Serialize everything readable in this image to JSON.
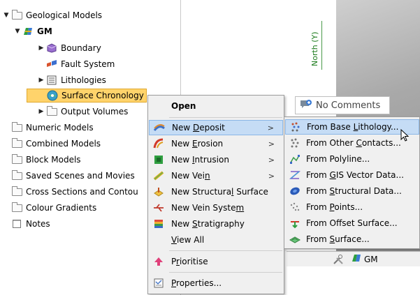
{
  "tree": {
    "items": [
      {
        "label": "Geological Models",
        "arrow": "▼",
        "icon": "folder-icon"
      },
      {
        "label": "GM",
        "arrow": "▼",
        "icon": "geomodel-icon"
      },
      {
        "label": "Boundary",
        "arrow": "▶",
        "icon": "boundary-icon"
      },
      {
        "label": "Fault System",
        "arrow": "",
        "icon": "fault-system-icon"
      },
      {
        "label": "Lithologies",
        "arrow": "▶",
        "icon": "list-icon"
      },
      {
        "label": "Surface Chronology",
        "arrow": "",
        "icon": "surface-chronology-icon"
      },
      {
        "label": "Output Volumes",
        "arrow": "▶",
        "icon": "folder-icon"
      },
      {
        "label": "Numeric Models",
        "arrow": "",
        "icon": "folder-icon"
      },
      {
        "label": "Combined Models",
        "arrow": "",
        "icon": "folder-icon"
      },
      {
        "label": "Block Models",
        "arrow": "",
        "icon": "folder-icon"
      },
      {
        "label": "Saved Scenes and Movies",
        "arrow": "",
        "icon": "folder-icon"
      },
      {
        "label": "Cross Sections and Contou",
        "arrow": "",
        "icon": "folder-icon"
      },
      {
        "label": "Colour Gradients",
        "arrow": "",
        "icon": "folder-icon"
      },
      {
        "label": "Notes",
        "arrow": "",
        "icon": "notes-icon"
      }
    ]
  },
  "viewport": {
    "axis_label": "North (Y)",
    "comment_label": "No Comments",
    "bottom_gm_label": "GM"
  },
  "context_menu": {
    "open": "Open",
    "new_deposit": {
      "pre": "New ",
      "u": "D",
      "post": "eposit"
    },
    "new_erosion": {
      "pre": "New ",
      "u": "E",
      "post": "rosion"
    },
    "new_intrusion": {
      "pre": "New ",
      "u": "I",
      "post": "ntrusion"
    },
    "new_vein": {
      "pre": "New Vei",
      "u": "n",
      "post": ""
    },
    "new_structural_surface": {
      "pre": "New Structura",
      "u": "l",
      "post": " Surface"
    },
    "new_vein_system": {
      "pre": "New Vein Syste",
      "u": "m",
      "post": ""
    },
    "new_stratigraphy": {
      "pre": "New ",
      "u": "S",
      "post": "tratigraphy"
    },
    "view_all": {
      "pre": "",
      "u": "V",
      "post": "iew All"
    },
    "prioritise": {
      "pre": "P",
      "u": "r",
      "post": "ioritise"
    },
    "properties": {
      "pre": "",
      "u": "P",
      "post": "roperties..."
    },
    "submenu_arrow": ">"
  },
  "submenu": {
    "from_base_lithology": {
      "pre": "From Base ",
      "u": "L",
      "post": "ithology..."
    },
    "from_other_contacts": {
      "pre": "From Other ",
      "u": "C",
      "post": "ontacts..."
    },
    "from_polyline": {
      "pre": "From Polyline...",
      "u": "",
      "post": ""
    },
    "from_gis": {
      "pre": "From ",
      "u": "G",
      "post": "IS Vector Data..."
    },
    "from_structural": {
      "pre": "From ",
      "u": "S",
      "post": "tructural Data..."
    },
    "from_points": {
      "pre": "From ",
      "u": "P",
      "post": "oints..."
    },
    "from_offset_surface": {
      "pre": "From Offset Surface...",
      "u": "",
      "post": ""
    },
    "from_surface": {
      "pre": "From ",
      "u": "S",
      "post": "urface..."
    }
  },
  "colors": {
    "selected_bg": "#ffd36b",
    "menu_highlight": "#c5dcf5",
    "menu_bg": "#f0f0f0"
  }
}
